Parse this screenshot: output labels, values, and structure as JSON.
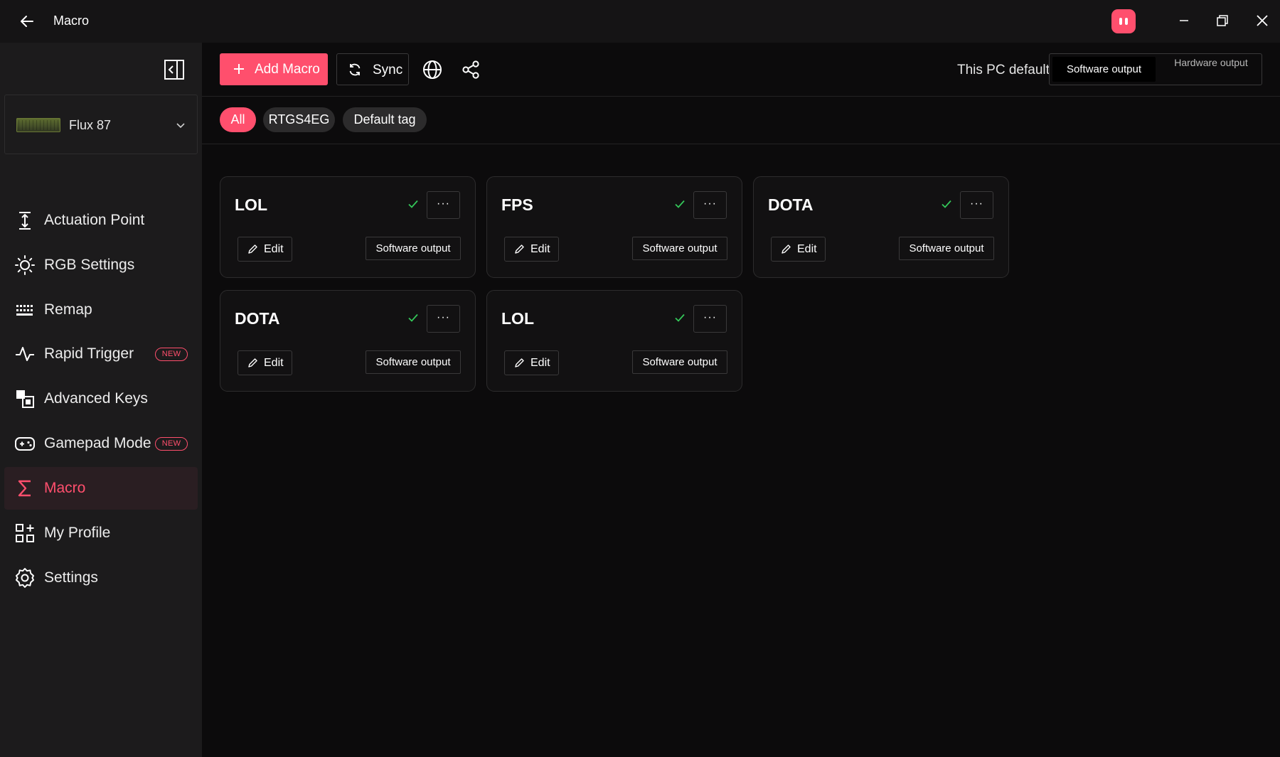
{
  "window": {
    "title": "Macro",
    "back_icon": "arrow-left-icon",
    "mascot_icon": "mascot-face-icon",
    "accent_color": "#ff4f6d"
  },
  "sidebar": {
    "device": {
      "name": "Flux 87"
    },
    "items": [
      {
        "label": "Actuation Point",
        "icon": "actuation-icon",
        "active": false
      },
      {
        "label": "RGB Settings",
        "icon": "sun-icon",
        "active": false
      },
      {
        "label": "Remap",
        "icon": "keyboard-icon",
        "active": false
      },
      {
        "label": "Rapid Trigger",
        "icon": "pulse-icon",
        "active": false,
        "badge": "NEW"
      },
      {
        "label": "Advanced Keys",
        "icon": "advanced-keys-icon",
        "active": false
      },
      {
        "label": "Gamepad Mode",
        "icon": "gamepad-icon",
        "active": false,
        "badge": "NEW"
      },
      {
        "label": "Macro",
        "icon": "sigma-icon",
        "active": true
      },
      {
        "label": "My Profile",
        "icon": "grid-plus-icon",
        "active": false
      },
      {
        "label": "Settings",
        "icon": "gear-icon",
        "active": false
      }
    ]
  },
  "toolbar": {
    "add_label": "Add Macro",
    "sync_label": "Sync",
    "pc_default_label": "This PC default",
    "output_options": [
      "Software output",
      "Hardware output"
    ],
    "selected_output": "Software output"
  },
  "tags": [
    "All",
    "RTGS4EG",
    "Default tag"
  ],
  "active_tag": "All",
  "macros": [
    {
      "title": "LOL",
      "enabled": true,
      "edit_label": "Edit",
      "output": "Software output"
    },
    {
      "title": "FPS",
      "enabled": true,
      "edit_label": "Edit",
      "output": "Software output"
    },
    {
      "title": "DOTA",
      "enabled": true,
      "edit_label": "Edit",
      "output": "Software output"
    },
    {
      "title": "DOTA",
      "enabled": true,
      "edit_label": "Edit",
      "output": "Software output"
    },
    {
      "title": "LOL",
      "enabled": true,
      "edit_label": "Edit",
      "output": "Software output"
    }
  ],
  "more_glyph": "···"
}
